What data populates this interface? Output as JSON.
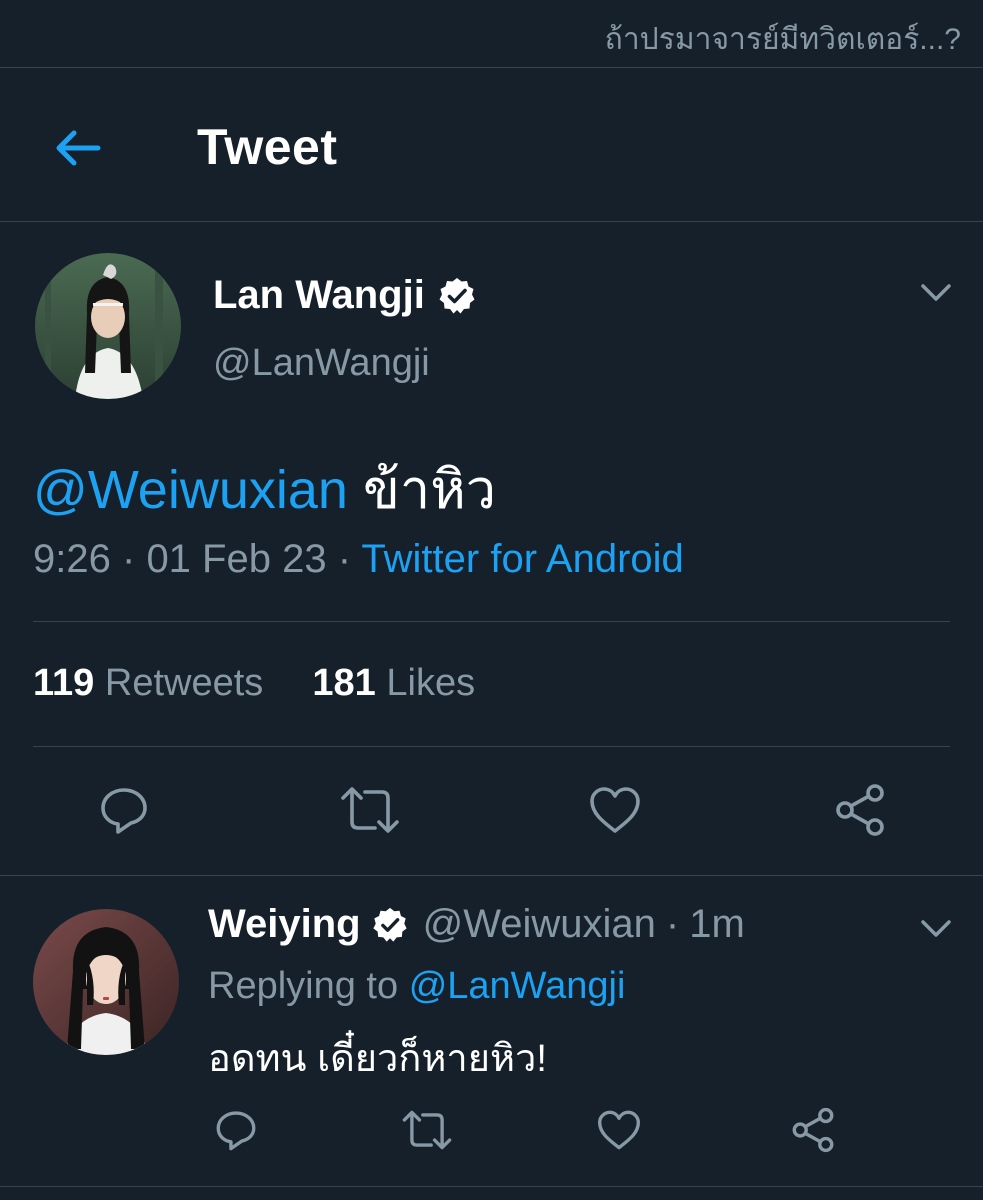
{
  "caption": "ถ้าปรมาจารย์มีทวิตเตอร์...?",
  "header": {
    "title": "Tweet",
    "back_icon": "arrow-left-icon",
    "accent": "#1da1f2"
  },
  "tweet": {
    "display_name": "Lan Wangji",
    "handle": "@LanWangji",
    "verified_icon": "verified-badge-icon",
    "mention": "@Weiwuxian",
    "text": "ข้าหิว",
    "time": "9:26",
    "date": "01 Feb 23",
    "separator": "·",
    "source": "Twitter for Android",
    "retweets_count": "119",
    "retweets_label": "Retweets",
    "likes_count": "181",
    "likes_label": "Likes",
    "actions": [
      "reply-icon",
      "retweet-icon",
      "like-icon",
      "share-icon"
    ]
  },
  "reply": {
    "display_name": "Weiying",
    "handle": "@Weiwuxian",
    "separator": "·",
    "time_ago": "1m",
    "replying_to_label": "Replying to",
    "replying_to_handle": "@LanWangji",
    "text": "อดทน เดี๋ยวก็หายหิว!",
    "actions": [
      "reply-icon",
      "retweet-icon",
      "like-icon",
      "share-icon"
    ]
  },
  "colors": {
    "background": "#15202b",
    "divider": "#38444d",
    "secondary_text": "#8899a6",
    "link": "#1da1f2"
  }
}
